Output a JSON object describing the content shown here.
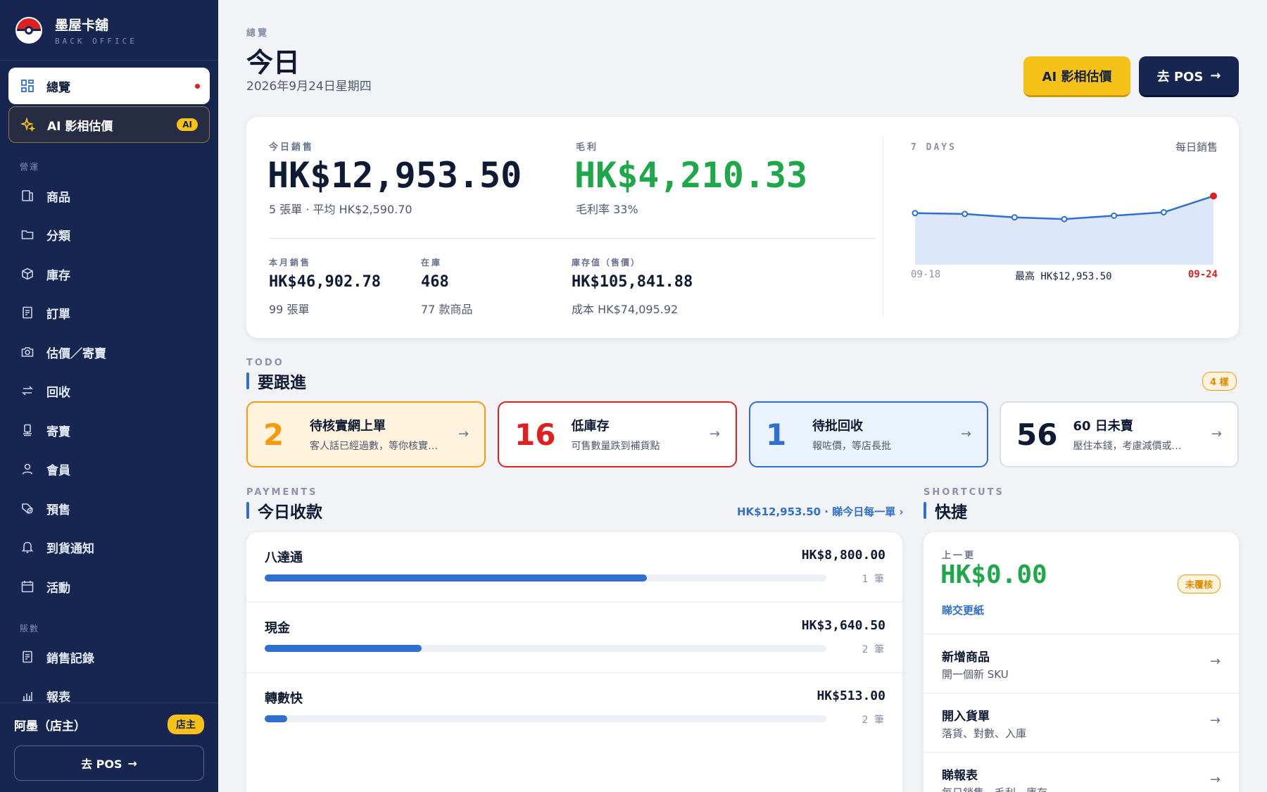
{
  "brand": {
    "name": "墨屋卡舖",
    "subtitle": "BACK OFFICE"
  },
  "sidebar": {
    "items_top": [
      {
        "label": "總覽",
        "icon": "grid-icon"
      },
      {
        "label": "AI 影相估價",
        "icon": "sparkle-icon",
        "badge": "AI"
      }
    ],
    "section_ops": "營運",
    "items_ops": [
      {
        "label": "商品",
        "icon": "product-icon"
      },
      {
        "label": "分類",
        "icon": "folder-icon"
      },
      {
        "label": "庫存",
        "icon": "box-icon"
      },
      {
        "label": "訂單",
        "icon": "receipt-icon"
      },
      {
        "label": "估價／寄賣",
        "icon": "camera-icon"
      },
      {
        "label": "回收",
        "icon": "swap-icon"
      },
      {
        "label": "寄賣",
        "icon": "stand-icon"
      },
      {
        "label": "會員",
        "icon": "user-icon"
      },
      {
        "label": "預售",
        "icon": "clock-tag-icon"
      },
      {
        "label": "到貨通知",
        "icon": "bell-icon"
      },
      {
        "label": "活動",
        "icon": "calendar-icon"
      }
    ],
    "section_accounts": "賬數",
    "items_accounts": [
      {
        "label": "銷售記錄",
        "icon": "receipt-icon"
      },
      {
        "label": "報表",
        "icon": "chart-icon"
      }
    ],
    "user": {
      "name": "阿墨（店主）",
      "role": "店主"
    },
    "pos_button": "去 POS"
  },
  "header": {
    "eyebrow": "總覽",
    "title": "今日",
    "date": "2026年9月24日星期四",
    "ai_button": "AI 影相估價",
    "pos_button": "去 POS"
  },
  "stats": {
    "today_label": "今日銷售",
    "today_value": "HK$12,953.50",
    "today_sub": "5 張單 · 平均 HK$2,590.70",
    "profit_label": "毛利",
    "profit_value": "HK$4,210.33",
    "profit_sub": "毛利率 33%",
    "month_label": "本月銷售",
    "month_value": "HK$46,902.78",
    "month_sub": "99 張單",
    "stock_label": "在庫",
    "stock_value": "468",
    "stock_sub": "77 款商品",
    "inv_label": "庫存值（售價）",
    "inv_value": "HK$105,841.88",
    "inv_sub": "成本 HK$74,095.92"
  },
  "mini_chart": {
    "label": "7 DAYS",
    "title": "每日銷售",
    "start_label": "09-18",
    "peak_label": "最高 HK$12,953.50",
    "end_label": "09-24",
    "accent": "#2f6fce",
    "end_color": "#e02020"
  },
  "todo": {
    "eyebrow": "TODO",
    "title": "要跟進",
    "count_badge": "4 樣",
    "items": [
      {
        "count": "2",
        "title": "待核實網上單",
        "desc": "客人話已經過數，等你核實…",
        "color": "#f59a0b",
        "bg": "#fff3de"
      },
      {
        "count": "16",
        "title": "低庫存",
        "desc": "可售數量跌到補貨點",
        "color": "#e02020",
        "bg": "#ffffff"
      },
      {
        "count": "1",
        "title": "待批回收",
        "desc": "報咗價，等店長批",
        "color": "#2f6fce",
        "bg": "#eaf2fd"
      },
      {
        "count": "56",
        "title": "60 日未賣",
        "desc": "壓住本錢，考慮減價或…",
        "color": "#0f1a33",
        "bg": "#ffffff"
      }
    ]
  },
  "payments": {
    "eyebrow": "PAYMENTS",
    "title": "今日收款",
    "link": "HK$12,953.50 · 睇今日每一單 ›",
    "rows": [
      {
        "name": "八達通",
        "amount": "HK$8,800.00",
        "count": "1 筆",
        "share": 0.68
      },
      {
        "name": "現金",
        "amount": "HK$3,640.50",
        "count": "2 筆",
        "share": 0.28
      },
      {
        "name": "轉數快",
        "amount": "HK$513.00",
        "count": "2 筆",
        "share": 0.04
      }
    ]
  },
  "shortcuts": {
    "eyebrow": "SHORTCUTS",
    "title": "快捷",
    "shift_label": "上一更",
    "shift_value": "HK$0.00",
    "shift_badge": "未覆核",
    "shift_link": "睇交更紙",
    "items": [
      {
        "title": "新增商品",
        "desc": "開一個新 SKU"
      },
      {
        "title": "開入貨單",
        "desc": "落貨、對數、入庫"
      },
      {
        "title": "睇報表",
        "desc": "每日銷售、毛利、庫存"
      }
    ]
  }
}
